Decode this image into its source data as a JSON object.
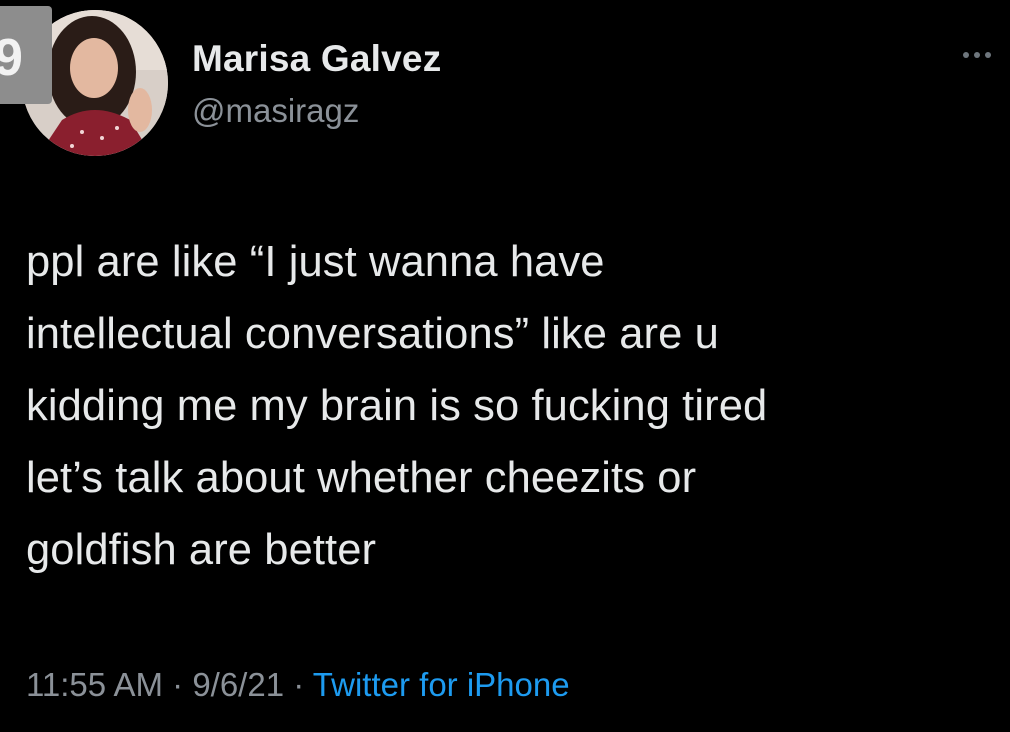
{
  "badge": {
    "text": "9"
  },
  "author": {
    "name": "Marisa Galvez",
    "handle": "@masiragz"
  },
  "tweet": {
    "lines": [
      "ppl are like “I just wanna have",
      "intellectual conversations” like are u",
      "kidding me my brain is so fucking tired",
      "let’s talk about whether cheezits or",
      "goldfish are better"
    ]
  },
  "meta": {
    "time": "11:55 AM",
    "separator": " · ",
    "date": "9/6/21",
    "source": "Twitter for iPhone"
  },
  "icons": {
    "more": "more-options-icon"
  },
  "colors": {
    "background": "#000000",
    "text": "#e7e9ea",
    "secondary": "#8b9198",
    "link": "#1d9bf0"
  }
}
